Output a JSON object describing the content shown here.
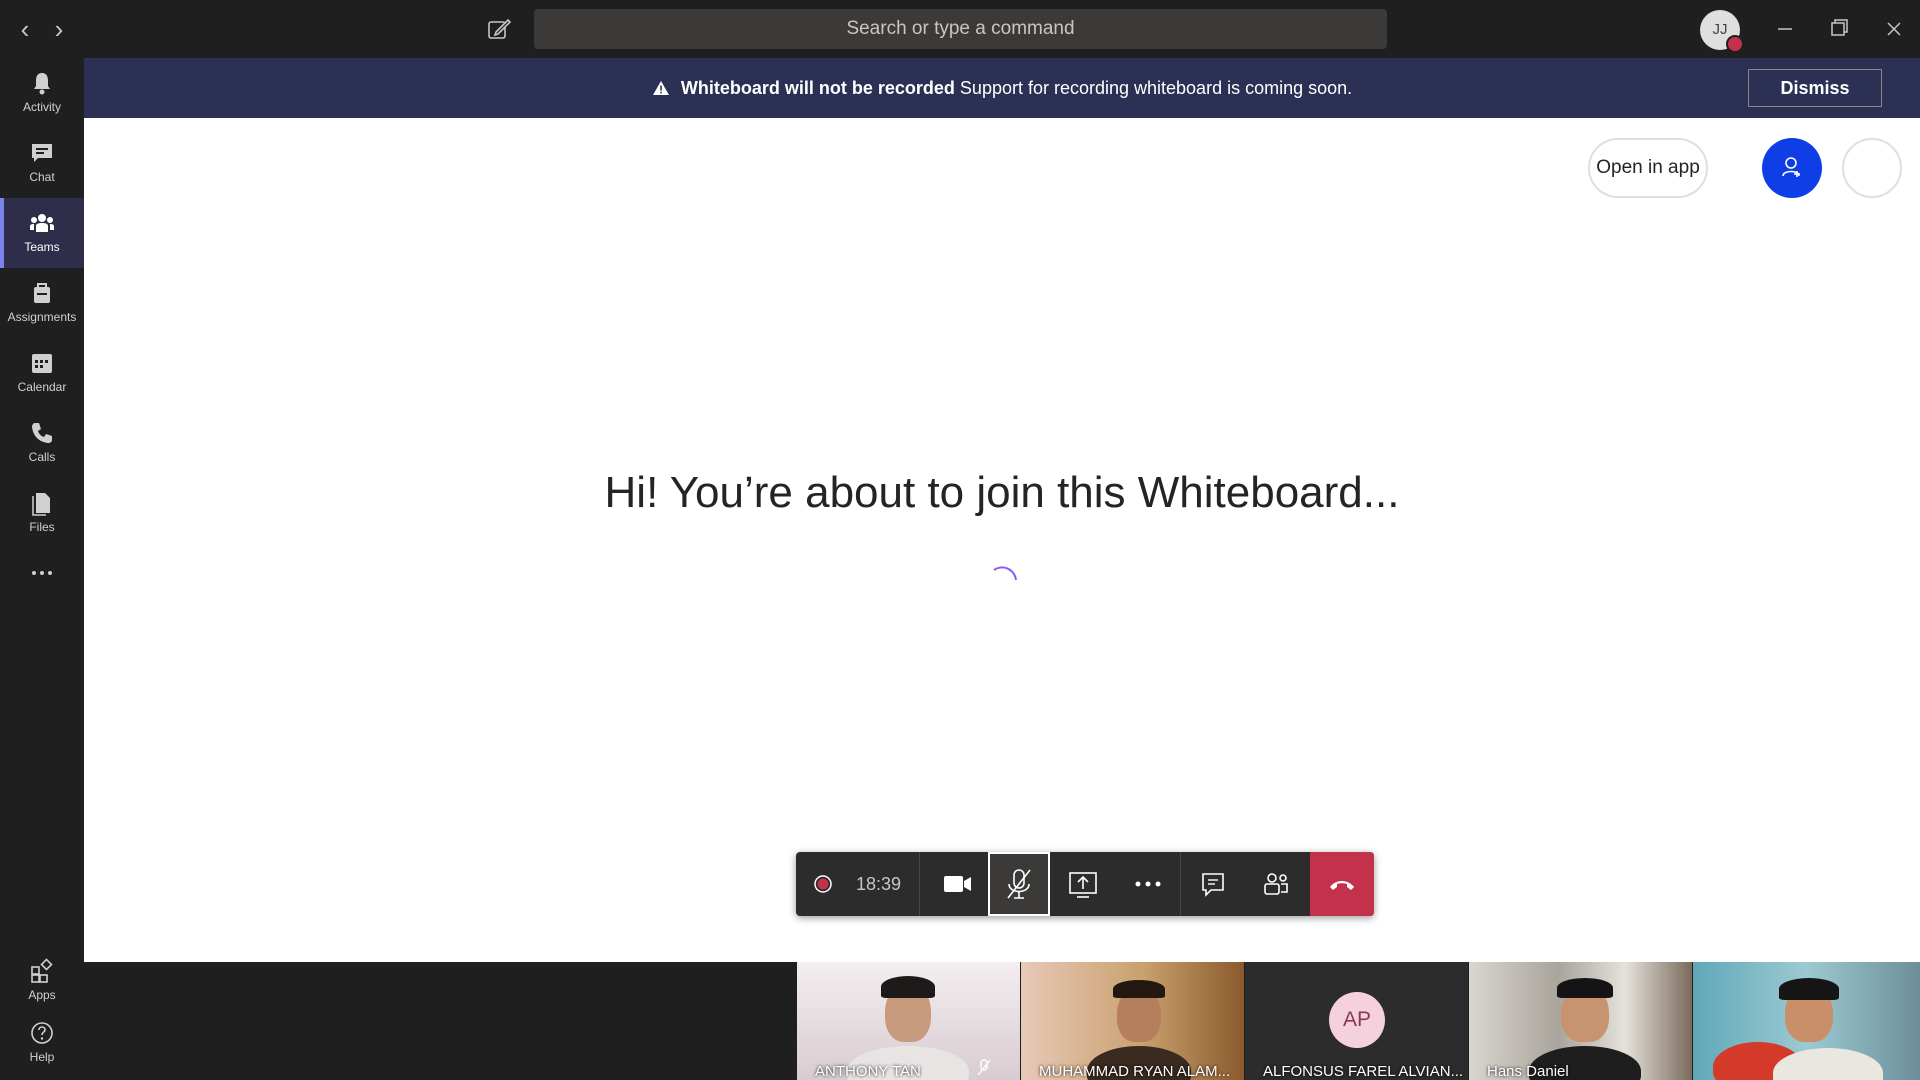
{
  "titlebar": {
    "search_placeholder": "Search or type a command",
    "avatar_initials": "JJ"
  },
  "rail": {
    "items": [
      {
        "label": "Activity",
        "icon": "bell-icon"
      },
      {
        "label": "Chat",
        "icon": "chat-icon"
      },
      {
        "label": "Teams",
        "icon": "teams-icon"
      },
      {
        "label": "Assignments",
        "icon": "assignments-icon"
      },
      {
        "label": "Calendar",
        "icon": "calendar-icon"
      },
      {
        "label": "Calls",
        "icon": "phone-icon"
      },
      {
        "label": "Files",
        "icon": "files-icon"
      }
    ],
    "apps_label": "Apps",
    "help_label": "Help"
  },
  "banner": {
    "title": "Whiteboard will not be recorded",
    "message": "Support for recording whiteboard is coming soon.",
    "dismiss_label": "Dismiss"
  },
  "whiteboard": {
    "open_in_app_label": "Open in app",
    "join_message": "Hi! You’re about to join this Whiteboard..."
  },
  "controls": {
    "timer": "18:39"
  },
  "participants": [
    {
      "name": "ANTHONY TAN"
    },
    {
      "name": "MUHAMMAD RYAN ALAM..."
    },
    {
      "name": "ALFONSUS FAREL ALVIAN...",
      "initials": "AP"
    },
    {
      "name": "Hans Daniel"
    },
    {
      "name": ""
    }
  ],
  "colors": {
    "banner_bg": "#2c3054",
    "accent_blue": "#0f3ee6",
    "hangup_red": "#c4314b",
    "rail_active": "#7b83eb"
  }
}
